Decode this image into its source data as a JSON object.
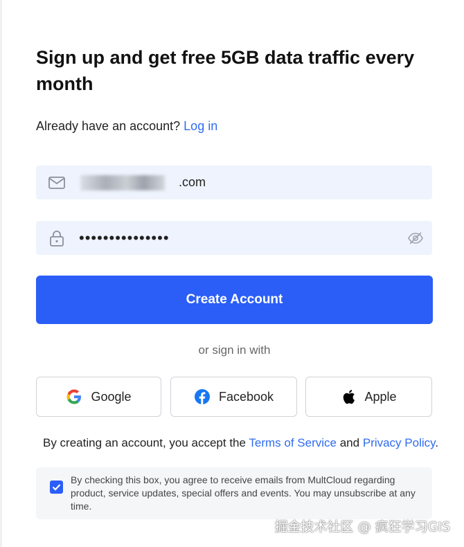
{
  "page": {
    "title": "Sign up and get free 5GB data traffic every month"
  },
  "login": {
    "prompt": "Already have an account?",
    "link_label": "Log in"
  },
  "form": {
    "email_value": "        .com",
    "password_value": "•••••••••••••••",
    "email_icon": "mail-icon",
    "password_icon": "lock-icon",
    "toggle_visibility_icon": "eye-off-icon",
    "submit_label": "Create Account"
  },
  "social": {
    "divider": "or sign in with",
    "buttons": [
      {
        "label": "Google",
        "icon": "google-icon"
      },
      {
        "label": "Facebook",
        "icon": "facebook-icon"
      },
      {
        "label": "Apple",
        "icon": "apple-icon"
      }
    ]
  },
  "terms": {
    "prefix": "By creating an account, you accept the",
    "tos_label": "Terms of Service",
    "and": "and",
    "privacy_label": "Privacy Policy",
    "suffix": "."
  },
  "consent": {
    "checked": true,
    "text": "By checking this box, you agree to receive emails from MultCloud regarding product, service updates, special offers and events. You may unsubscribe at any time."
  },
  "watermark": "掘金技术社区 @ 疯狂学习GIS",
  "colors": {
    "accent": "#2b5ef7",
    "link": "#2f6bef",
    "field_bg": "#eef3fd",
    "facebook": "#1877f2"
  }
}
